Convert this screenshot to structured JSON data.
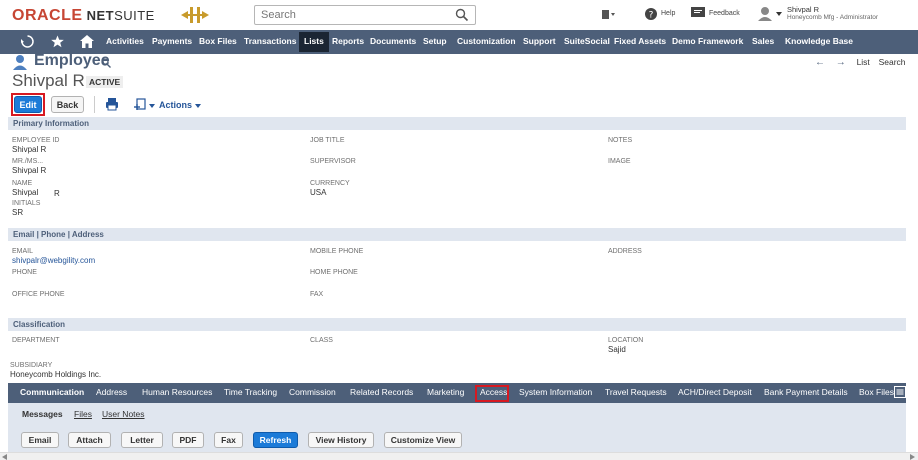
{
  "topbar": {
    "logo_oracle": "ORACLE",
    "logo_net": "NET",
    "logo_suite": "SUITE",
    "search_placeholder": "Search",
    "help": "Help",
    "feedback": "Feedback",
    "user_name": "Shivpal R",
    "user_role": "Honeycomb Mfg - Administrator"
  },
  "nav": {
    "items": [
      "Activities",
      "Payments",
      "Box Files",
      "Transactions",
      "Lists",
      "Reports",
      "Documents",
      "Setup",
      "Customization",
      "Support",
      "SuiteSocial",
      "Fixed Assets",
      "Demo Framework",
      "Sales",
      "Knowledge Base"
    ],
    "active": "Lists"
  },
  "record": {
    "type": "Employee",
    "name": "Shivpal R",
    "status": "ACTIVE",
    "list_link": "List",
    "search_link": "Search"
  },
  "buttons": {
    "edit": "Edit",
    "back": "Back",
    "actions": "Actions"
  },
  "sections": {
    "primary": "Primary Information",
    "email": "Email | Phone | Address",
    "classification": "Classification"
  },
  "fields": {
    "employee_id_label": "EMPLOYEE ID",
    "employee_id": "Shivpal R",
    "mr_ms_label": "MR./MS...",
    "mr_ms": "Shivpal R",
    "name_label": "NAME",
    "name_first": "Shivpal",
    "name_last": "R",
    "initials_label": "INITIALS",
    "initials": "SR",
    "job_title_label": "JOB TITLE",
    "supervisor_label": "SUPERVISOR",
    "currency_label": "CURRENCY",
    "currency": "USA",
    "notes_label": "NOTES",
    "image_label": "IMAGE",
    "email_label": "EMAIL",
    "email": "shivpalr@webgility.com",
    "phone_label": "PHONE",
    "office_phone_label": "OFFICE PHONE",
    "mobile_phone_label": "MOBILE PHONE",
    "home_phone_label": "HOME PHONE",
    "fax_label": "FAX",
    "address_label": "ADDRESS",
    "department_label": "DEPARTMENT",
    "class_label": "CLASS",
    "location_label": "LOCATION",
    "location": "Sajid",
    "subsidiary_label": "SUBSIDIARY",
    "subsidiary": "Honeycomb Holdings Inc."
  },
  "subtabs": [
    "Communication",
    "Address",
    "Human Resources",
    "Time Tracking",
    "Commission",
    "Related Records",
    "Marketing",
    "Access",
    "System Information",
    "Travel Requests",
    "ACH/Direct Deposit",
    "Bank Payment Details",
    "Box Files"
  ],
  "inner_tabs": [
    "Messages",
    "Files",
    "User Notes"
  ],
  "inner_buttons": [
    "Email",
    "Attach",
    "Letter",
    "PDF",
    "Fax",
    "Refresh",
    "View History",
    "Customize View"
  ],
  "colors": {
    "nav_bg": "#4d5f79",
    "accent_blue": "#1c7bd8",
    "highlight_red": "#d71921",
    "oracle_red": "#c74634"
  }
}
